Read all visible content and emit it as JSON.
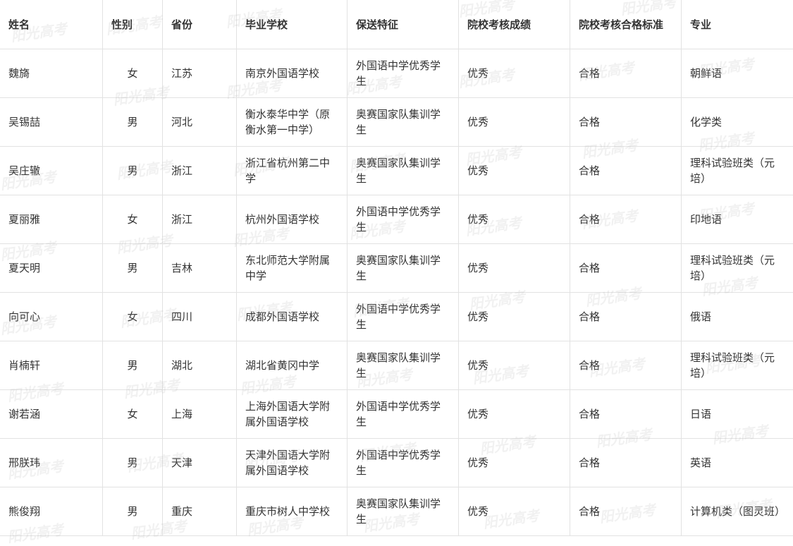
{
  "table": {
    "headers": [
      "姓名",
      "性别",
      "省份",
      "毕业学校",
      "保送特征",
      "院校考核成绩",
      "院校考核合格标准",
      "专业"
    ],
    "rows": [
      [
        "魏旖",
        "女",
        "江苏",
        "南京外国语学校",
        "外国语中学优秀学生",
        "优秀",
        "合格",
        "朝鲜语"
      ],
      [
        "吴锡喆",
        "男",
        "河北",
        "衡水泰华中学（原衡水第一中学）",
        "奥赛国家队集训学生",
        "优秀",
        "合格",
        "化学类"
      ],
      [
        "吴庄辙",
        "男",
        "浙江",
        "浙江省杭州第二中学",
        "奥赛国家队集训学生",
        "优秀",
        "合格",
        "理科试验班类（元培）"
      ],
      [
        "夏丽雅",
        "女",
        "浙江",
        "杭州外国语学校",
        "外国语中学优秀学生",
        "优秀",
        "合格",
        "印地语"
      ],
      [
        "夏天明",
        "男",
        "吉林",
        "东北师范大学附属中学",
        "奥赛国家队集训学生",
        "优秀",
        "合格",
        "理科试验班类（元培）"
      ],
      [
        "向可心",
        "女",
        "四川",
        "成都外国语学校",
        "外国语中学优秀学生",
        "优秀",
        "合格",
        "俄语"
      ],
      [
        "肖楠轩",
        "男",
        "湖北",
        "湖北省黄冈中学",
        "奥赛国家队集训学生",
        "优秀",
        "合格",
        "理科试验班类（元培）"
      ],
      [
        "谢若涵",
        "女",
        "上海",
        "上海外国语大学附属外国语学校",
        "外国语中学优秀学生",
        "优秀",
        "合格",
        "日语"
      ],
      [
        "邢朕玮",
        "男",
        "天津",
        "天津外国语大学附属外国语学校",
        "外国语中学优秀学生",
        "优秀",
        "合格",
        "英语"
      ],
      [
        "熊俊翔",
        "男",
        "重庆",
        "重庆市树人中学校",
        "奥赛国家队集训学生",
        "优秀",
        "合格",
        "计算机类（图灵班）"
      ]
    ]
  },
  "watermark": "阳光高考"
}
